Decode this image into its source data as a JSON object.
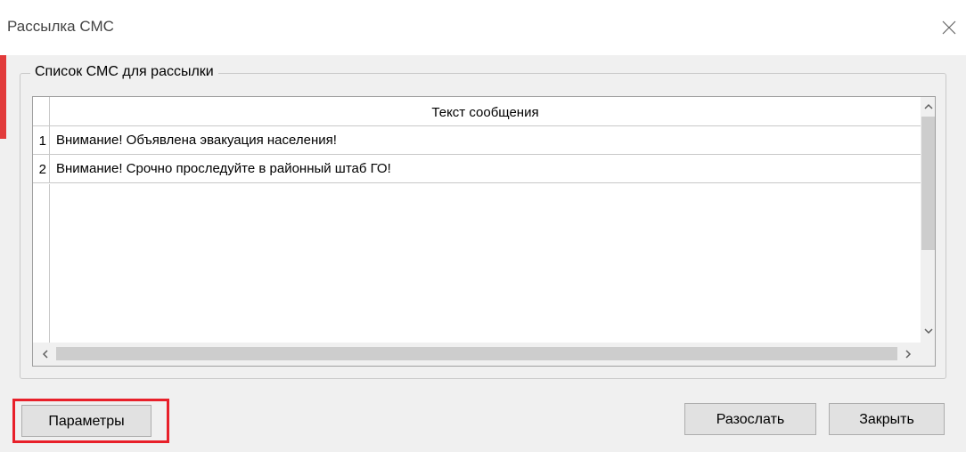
{
  "window": {
    "title": "Рассылка СМС"
  },
  "group": {
    "label": "Список СМС для рассылки"
  },
  "grid": {
    "column_header": "Текст сообщения",
    "rows": [
      {
        "num": "1",
        "text": "Внимание! Объявлена эвакуация населения!"
      },
      {
        "num": "2",
        "text": "Внимание! Срочно проследуйте в районный штаб ГО!"
      }
    ]
  },
  "buttons": {
    "params": "Параметры",
    "send": "Разослать",
    "close": "Закрыть"
  },
  "icons": {
    "close": "close-icon",
    "scroll_up": "chevron-up-icon",
    "scroll_down": "chevron-down-icon",
    "scroll_left": "chevron-left-icon",
    "scroll_right": "chevron-right-icon"
  },
  "colors": {
    "highlight": "#e8202a",
    "dialog_bg": "#f0f0f0"
  }
}
